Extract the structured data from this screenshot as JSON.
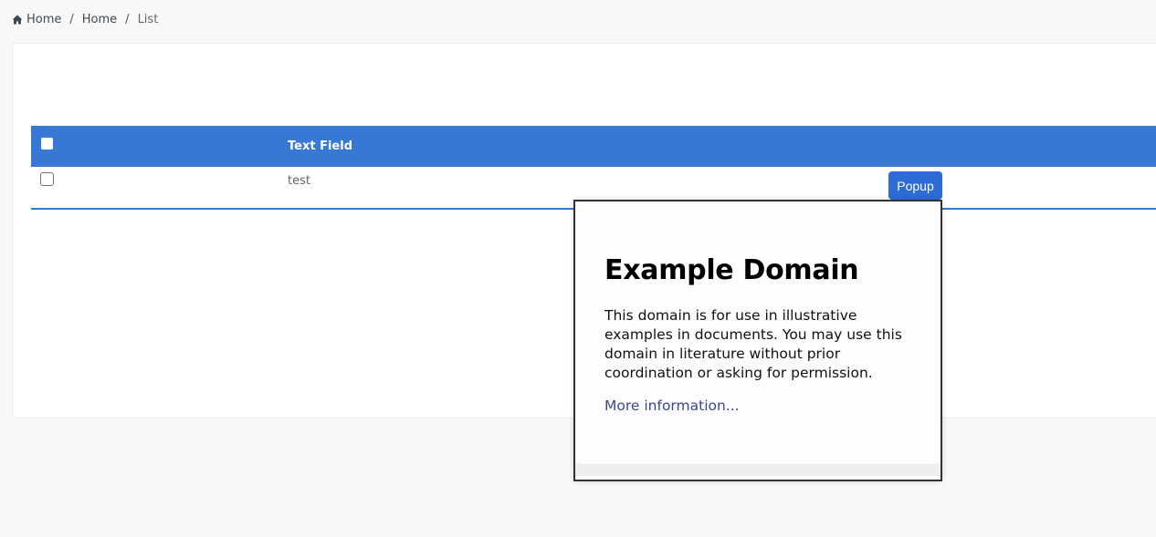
{
  "breadcrumb": {
    "items": [
      {
        "label": "Home",
        "icon": "home-icon"
      },
      {
        "label": "Home"
      },
      {
        "label": "List"
      }
    ],
    "separator": "/"
  },
  "table": {
    "header": {
      "text_field": "Text Field"
    },
    "rows": [
      {
        "text_field": "test",
        "action_label": "Popup"
      }
    ]
  },
  "popup": {
    "title": "Example Domain",
    "body": "This domain is for use in illustrative examples in documents. You may use this domain in literature without prior coordination or asking for permission.",
    "link": "More information..."
  },
  "colors": {
    "accent": "#3778d4",
    "button": "#2d6bd6",
    "link": "#38488f"
  }
}
